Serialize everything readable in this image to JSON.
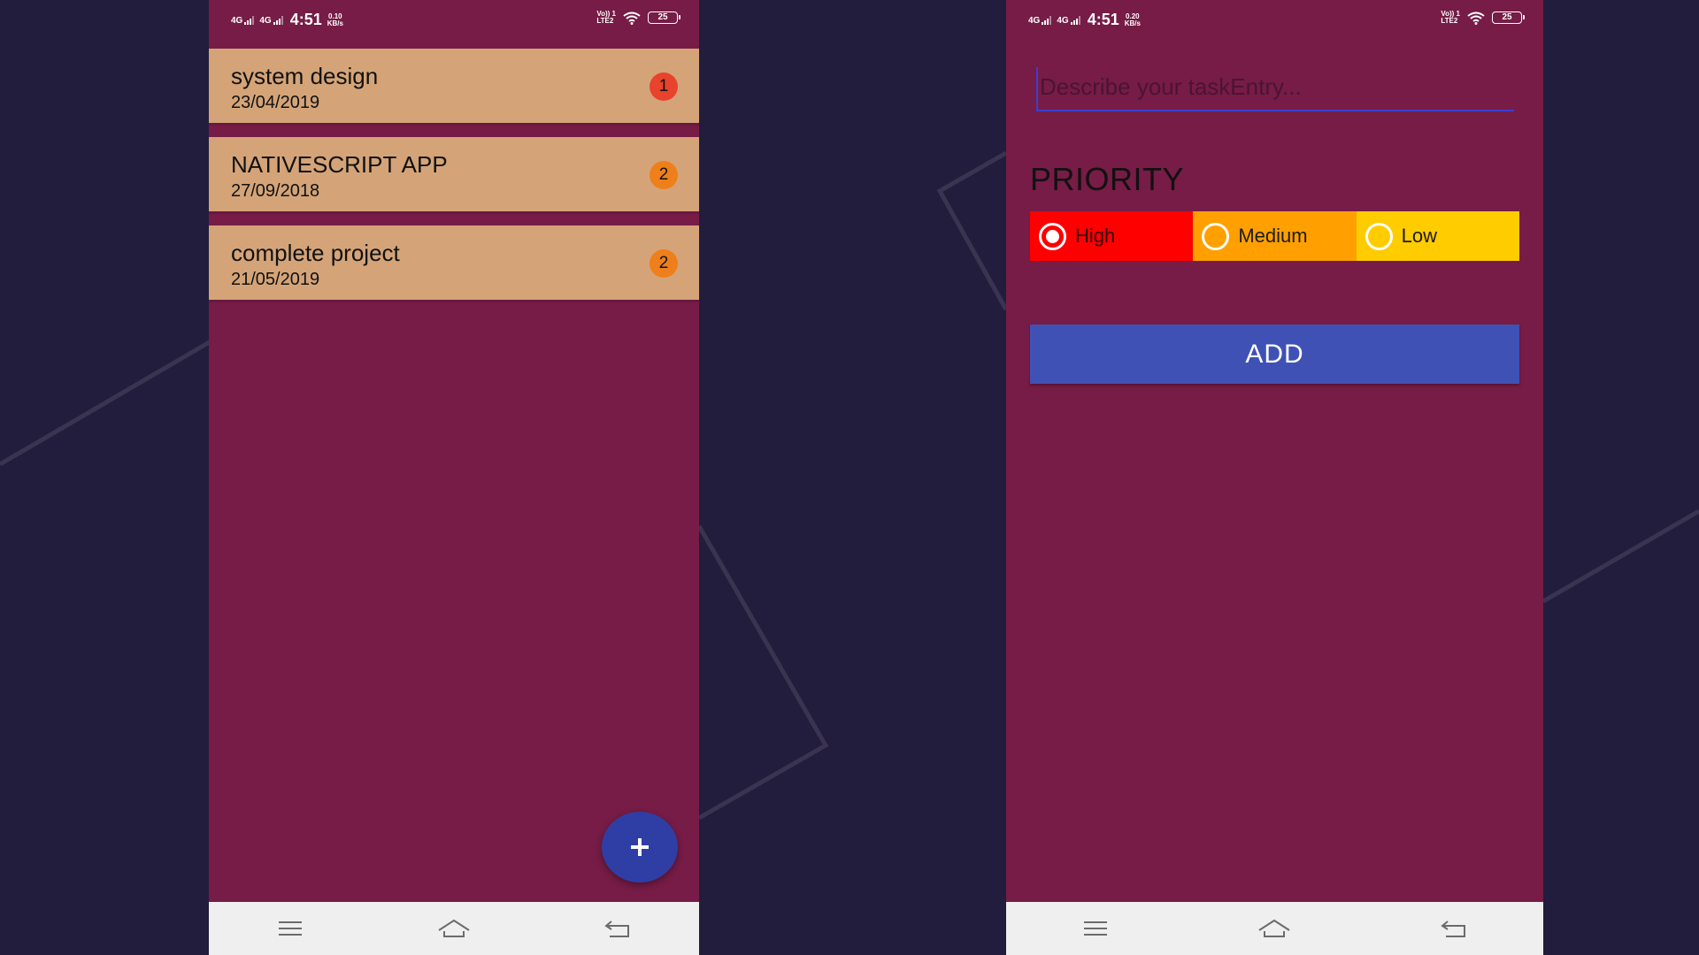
{
  "status_bar_left": {
    "network1": "4G",
    "network2": "4G",
    "time": "4:51",
    "speed_value": "0.10",
    "speed_unit": "KB/s",
    "volte": "Vo)) 1",
    "lte": "LTE2",
    "battery": "25"
  },
  "status_bar_right": {
    "network1": "4G",
    "network2": "4G",
    "time": "4:51",
    "speed_value": "0.20",
    "speed_unit": "KB/s",
    "volte": "Vo)) 1",
    "lte": "LTE2",
    "battery": "25"
  },
  "task_list": {
    "tasks": [
      {
        "name": "system design",
        "date": "23/04/2019",
        "priority": "1",
        "badge_color": "#e8432d"
      },
      {
        "name": "NATIVESCRIPT APP",
        "date": "27/09/2018",
        "priority": "2",
        "badge_color": "#ef7f1a"
      },
      {
        "name": "complete project",
        "date": "21/05/2019",
        "priority": "2",
        "badge_color": "#ef7f1a"
      }
    ],
    "fab_icon": "plus-icon"
  },
  "entry_form": {
    "input_placeholder": "Describe your taskEntry...",
    "input_value": "",
    "priority_title": "PRIORITY",
    "options": [
      {
        "label": "High",
        "selected": true,
        "color": "#ff0000"
      },
      {
        "label": "Medium",
        "selected": false,
        "color": "#ffa000"
      },
      {
        "label": "Low",
        "selected": false,
        "color": "#ffcc00"
      }
    ],
    "add_label": "ADD"
  },
  "nav_icons": [
    "menu-icon",
    "home-icon",
    "back-icon"
  ],
  "colors": {
    "background": "#221d3d",
    "app_background": "#761c46",
    "card": "#d4a478",
    "accent": "#3f51b5",
    "fab": "#2f3ea5"
  }
}
